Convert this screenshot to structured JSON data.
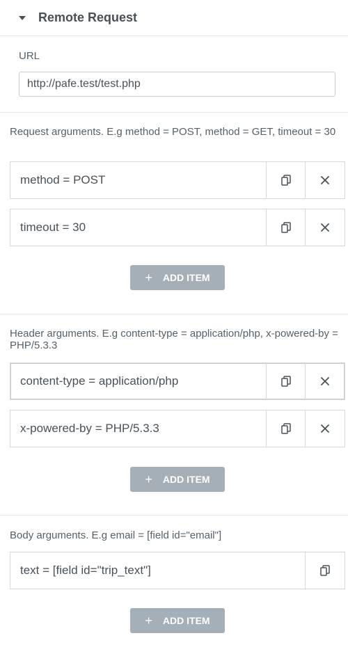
{
  "section": {
    "title": "Remote Request"
  },
  "url": {
    "label": "URL",
    "value": "http://pafe.test/test.php"
  },
  "request_args": {
    "label": "Request arguments. E.g method = POST, method = GET, timeout = 30",
    "items": [
      {
        "title": "method = POST"
      },
      {
        "title": "timeout = 30"
      }
    ],
    "add_label": "ADD ITEM"
  },
  "header_args": {
    "label": "Header arguments. E.g content-type = application/php, x-powered-by = PHP/5.3.3",
    "items": [
      {
        "title": "content-type = application/php"
      },
      {
        "title": "x-powered-by = PHP/5.3.3"
      }
    ],
    "add_label": "ADD ITEM"
  },
  "body_args": {
    "label": "Body arguments. E.g email = [field id=\"email\"]",
    "items": [
      {
        "title": "text = [field id=\"trip_text\"]"
      }
    ],
    "add_label": "ADD ITEM"
  },
  "icons": {
    "duplicate": "duplicate-icon",
    "remove": "close-icon",
    "toggle": "caret-down-icon"
  },
  "colors": {
    "button_bg": "#a4afb7",
    "text": "#495157",
    "border": "#d5d8dc"
  }
}
